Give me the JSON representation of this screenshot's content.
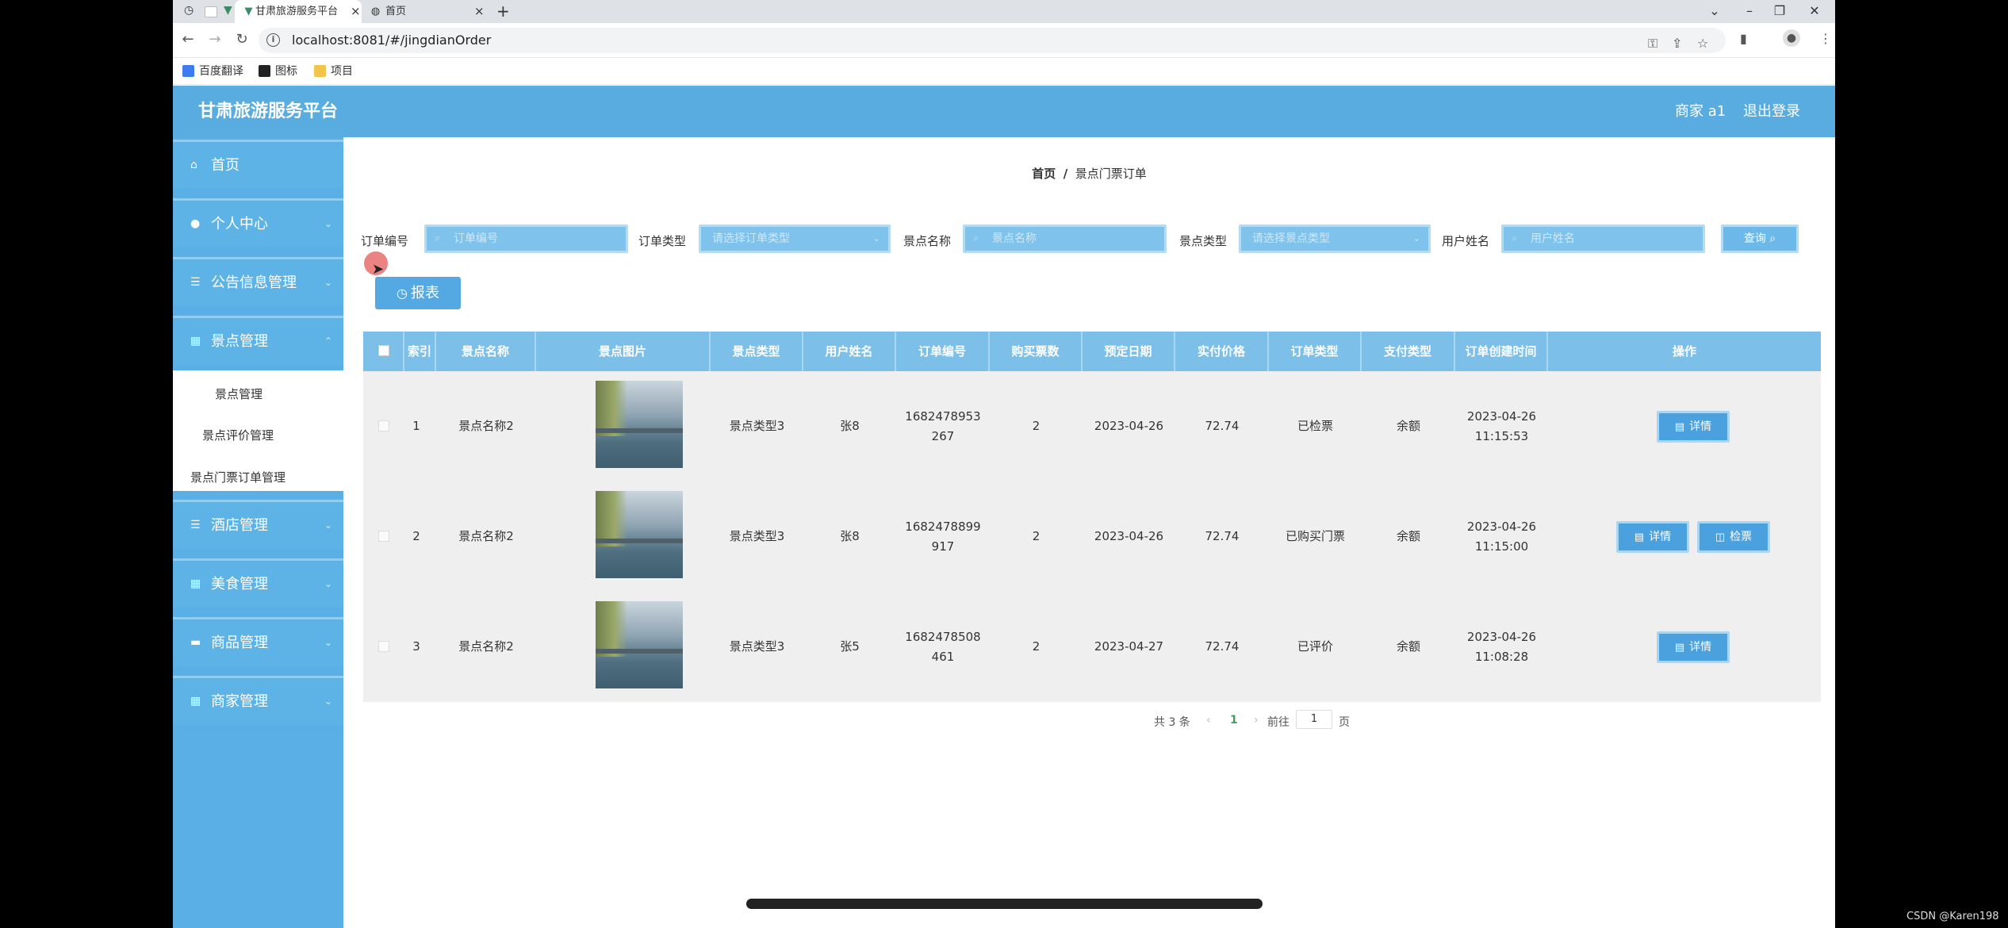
{
  "browser": {
    "tabs": [
      {
        "title": "甘肃旅游服务平台",
        "active": true
      },
      {
        "title": "首页",
        "active": false
      }
    ],
    "new_tab_symbol": "+",
    "url": "localhost:8081/#/jingdianOrder",
    "bookmarks": [
      "百度翻译",
      "图标",
      "项目"
    ]
  },
  "header": {
    "brand": "甘肃旅游服务平台",
    "user": "商家 a1",
    "logout": "退出登录"
  },
  "sidebar": {
    "items": [
      {
        "label": "首页",
        "icon": "home-icon"
      },
      {
        "label": "个人中心",
        "icon": "user-icon"
      },
      {
        "label": "公告信息管理",
        "icon": "list-icon"
      },
      {
        "label": "景点管理",
        "icon": "grid-icon"
      },
      {
        "label": "酒店管理",
        "icon": "list-icon"
      },
      {
        "label": "美食管理",
        "icon": "grid-icon"
      },
      {
        "label": "商品管理",
        "icon": "chat-icon"
      },
      {
        "label": "商家管理",
        "icon": "grid-icon"
      }
    ],
    "sub_items": [
      "景点管理",
      "景点评价管理",
      "景点门票订单管理"
    ]
  },
  "breadcrumb": {
    "home": "首页",
    "separator": "/",
    "current": "景点门票订单"
  },
  "filters": [
    {
      "label": "订单编号",
      "placeholder": "订单编号",
      "type": "input"
    },
    {
      "label": "订单类型",
      "placeholder": "请选择订单类型",
      "type": "select"
    },
    {
      "label": "景点名称",
      "placeholder": "景点名称",
      "type": "input"
    },
    {
      "label": "景点类型",
      "placeholder": "请选择景点类型",
      "type": "select"
    },
    {
      "label": "用户姓名",
      "placeholder": "用户姓名",
      "type": "input"
    }
  ],
  "search_button": "查询",
  "report_button": "报表",
  "table": {
    "columns": [
      "索引",
      "景点名称",
      "景点图片",
      "景点类型",
      "用户姓名",
      "订单编号",
      "购买票数",
      "预定日期",
      "实付价格",
      "订单类型",
      "支付类型",
      "订单创建时间",
      "操作"
    ],
    "rows": [
      {
        "index": "1",
        "name": "景点名称2",
        "type": "景点类型3",
        "user": "张8",
        "order_no_1": "1682478953",
        "order_no_2": "267",
        "qty": "2",
        "date": "2023-04-26",
        "price": "72.74",
        "order_type": "已检票",
        "pay_type": "余额",
        "created_1": "2023-04-26",
        "created_2": "11:15:53",
        "actions": [
          "详情"
        ]
      },
      {
        "index": "2",
        "name": "景点名称2",
        "type": "景点类型3",
        "user": "张8",
        "order_no_1": "1682478899",
        "order_no_2": "917",
        "qty": "2",
        "date": "2023-04-26",
        "price": "72.74",
        "order_type": "已购买门票",
        "pay_type": "余额",
        "created_1": "2023-04-26",
        "created_2": "11:15:00",
        "actions": [
          "详情",
          "检票"
        ]
      },
      {
        "index": "3",
        "name": "景点名称2",
        "type": "景点类型3",
        "user": "张5",
        "order_no_1": "1682478508",
        "order_no_2": "461",
        "qty": "2",
        "date": "2023-04-27",
        "price": "72.74",
        "order_type": "已评价",
        "pay_type": "余额",
        "created_1": "2023-04-26",
        "created_2": "11:08:28",
        "actions": [
          "详情"
        ]
      }
    ]
  },
  "pagination": {
    "total": "共 3 条",
    "current_page": "1",
    "goto_label": "前往",
    "goto_value": "1",
    "page_unit": "页"
  },
  "watermark": "CSDN @Karen198",
  "colors": {
    "header": "#58acdf",
    "sidebar": "#5aafe6",
    "table_header": "#7cbfe8",
    "button": "#4aa1dd"
  }
}
